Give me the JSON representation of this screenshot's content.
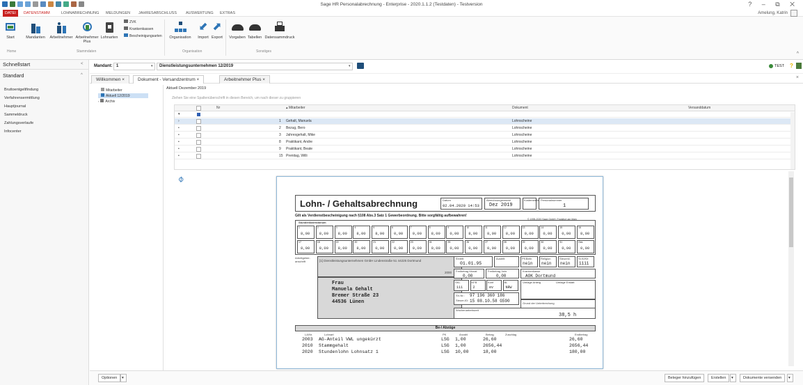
{
  "window": {
    "title": "Sage HR Personalabrechnung - Enterprise - 2020.1.1.2 (Testdaten) - Testversion",
    "controls": "? – ⧉ ✕",
    "user": "Amelung, Katrin"
  },
  "ribbon_tabs": [
    "DATEI",
    "DATENSTAMM",
    "LOHNABRECHNUNG",
    "MELDUNGEN",
    "JAHRESABSCHLUSS",
    "AUSWERTUNG",
    "EXTRAS"
  ],
  "ribbon": {
    "start": "Start",
    "mandanten": "Mandanten",
    "arbeitnehmer": "Arbeitnehmer",
    "arbeitnehmer_plus": "Arbeitnehmer Plus",
    "lohnarten": "Lohnarten",
    "zvk": "ZVK",
    "krankenkassen": "Krankenkassen",
    "bescheinigungsarten": "Bescheinigungsarten",
    "organisation": "Organisation",
    "import": "Import",
    "export": "Export",
    "vorgaben": "Vorgaben",
    "tabellen": "Tabellen",
    "datensammdruck": "Datensammdruck",
    "group_home": "Home",
    "group_stammdaten": "Stammdaten",
    "group_organisation": "Organisation",
    "group_sonstiges": "Sonstiges"
  },
  "left_panel": {
    "schnellstart": "Schnellstart",
    "standard": "Standard",
    "items": [
      "Bruttoentgeltfindung",
      "Verfahrensermittlung",
      "Hauptjournal",
      "Sammeldruck",
      "Zahlungsverlaufe",
      "Infocenter"
    ]
  },
  "toolbar": {
    "mandant_label": "Mandant:",
    "mandant_value": "1",
    "dienstleister": "Dienstleistungsunternehmen 12/2019",
    "test_label": "TEST"
  },
  "doc_tabs": [
    "Willkommen",
    "Dokument - Versandzentrum",
    "Arbeitnehmer Plus"
  ],
  "tree": {
    "mitarbeiter": "Mitarbeiter",
    "aktuell": "Aktuell 12/2019",
    "archiv": "Archiv"
  },
  "content": {
    "period": "Aktuell Dezember 2019",
    "group_hint": "Ziehen Sie eine Spaltenüberschrift in diesen Bereich, um nach dieser zu gruppieren"
  },
  "grid": {
    "columns": [
      "Nr",
      "Mitarbeiter",
      "Dokument",
      "Versanddatum"
    ],
    "rows": [
      {
        "nr": "1",
        "name": "Gehalt, Manuela",
        "doc": "Lohnscheine"
      },
      {
        "nr": "2",
        "name": "Bezug, Bero",
        "doc": "Lohnscheine"
      },
      {
        "nr": "3",
        "name": "Jahresgehalt, Mike",
        "doc": "Lohnscheine"
      },
      {
        "nr": "8",
        "name": "Praktikant, Andre",
        "doc": "Lohnscheine"
      },
      {
        "nr": "9",
        "name": "Praktikant, Beate",
        "doc": "Lohnscheine"
      },
      {
        "nr": "15",
        "name": "Prenitag, Willi",
        "doc": "Lohnscheine"
      }
    ]
  },
  "payslip": {
    "heading": "Lohn- / Gehaltsabrechnung",
    "datum_label": "Datum",
    "datum": "02.04.2020 14:53",
    "monat_label": "Abrechnungsmonat",
    "monat": "Dez 2019",
    "kostenstelle_label": "Kostenstelle",
    "personalnummer_label": "Personalnummer",
    "personalnummer": "1",
    "notice": "Gilt als Verdienstbescheinigung nach §108 Abs.3 Satz 1 Gewerbeordnung. Bitte sorgfältig aufbewahren!",
    "copyright": "© 1995-2020 Sage GmbH, Frankfurt am Main",
    "kalender_label": "Stundenkalendarium",
    "days1": [
      "1",
      "2",
      "3",
      "4",
      "5",
      "6",
      "7",
      "8",
      "9",
      "10",
      "11",
      "12",
      "13",
      "14",
      "15",
      "16"
    ],
    "vals1": [
      "8,00",
      "8,00",
      "8,00",
      "8,00",
      "8,00",
      "0,00",
      "0,00",
      "8,00",
      "0,00",
      "8,00",
      "8,00",
      "8,00",
      "0,00",
      "0,00",
      "0,00",
      "8,00"
    ],
    "days2": [
      "17",
      "18",
      "19",
      "20",
      "21",
      "22",
      "23",
      "24",
      "25",
      "26",
      "27",
      "28",
      "29",
      "30",
      "31",
      "Ges"
    ],
    "vals2": [
      "8,00",
      "8,00",
      "8,00",
      "8,00",
      "0,00",
      "0,00",
      "0,00",
      "0,00",
      "0,00",
      "0,00",
      "0,00",
      "0,00",
      "0,00",
      "0,00",
      "0,00",
      "0,00"
    ],
    "arbeitgeber_label": "Arbeitgeber-anschrift",
    "arbeitgeber": "[1] Dienstleistungsunternehmen GmbH  Lindenstraße 51  44225 Dortmund",
    "arbeitgeber_id": "2000",
    "eintritt_label": "Eintritt",
    "eintritt": "01.01.95",
    "austritt_label": "Austritt",
    "ms_labels": [
      "Pfl.Beitr.",
      "Religion",
      "Steuerkl.",
      "St.Kl/Kfr."
    ],
    "ms_values": [
      "nein",
      "nein",
      "nein",
      "1111"
    ],
    "freibetrag_monat_label": "Freibetrag Monat",
    "freibetrag_monat": "0,00",
    "freibetrag_jahr_label": "Freibetrag Jahr",
    "freibetrag_jahr": "0,00",
    "krankenkasse_label": "Krankenkasse",
    "krankenkasse": "AOK Dortmund",
    "anrede": "Frau",
    "name": "Manuela Gehalt",
    "strasse": "Bremer Straße 23",
    "ort": "44536 Lünen",
    "sv_labels": [
      "SKL",
      "KFB",
      "Konf",
      "BL"
    ],
    "sv_values": [
      "111",
      "2",
      "ev",
      "NRW"
    ],
    "umlage_label": "Umlage Anteig",
    "umlage2_label": "Umlage Erstatt",
    "svnr": "97 196 360 186",
    "steuernr": "15 08.10.58 G590",
    "svnr_labels": [
      "SV-Nr.:",
      "Steuer-ID:"
    ],
    "grund_label": "Grund der Unterbrechung",
    "wochenarbeitszeit_label": "Wochenarbeitszeit",
    "wochenarbeitszeit": "38,5 h",
    "bezuege_label": "Be-/ Abzüge",
    "lines_head": [
      "LA/Nr.",
      "Lohnart",
      "PK",
      "Anzahl",
      "Betrag",
      "Zuschlag",
      "Endbetrag"
    ],
    "lines": [
      {
        "nr": "2003",
        "text": "AG-Anteil VWL ungekürzt",
        "pk": "LSG",
        "anz": "1,00",
        "betrag": "26,60",
        "end": "26,60"
      },
      {
        "nr": "2010",
        "text": "Stammgehalt",
        "pk": "LSG",
        "anz": "1,00",
        "betrag": "2656,44",
        "end": "2656,44"
      },
      {
        "nr": "2020",
        "text": "Stundenlohn Lohnsatz 1",
        "pk": "LSG",
        "anz": "10,00",
        "betrag": "18,00",
        "end": "180,00"
      }
    ]
  },
  "bottom": {
    "optionen": "Optionen",
    "beleger": "Beleger hinzufügen",
    "erstellen": "Erstellen",
    "versenden": "Dokumente versenden"
  }
}
